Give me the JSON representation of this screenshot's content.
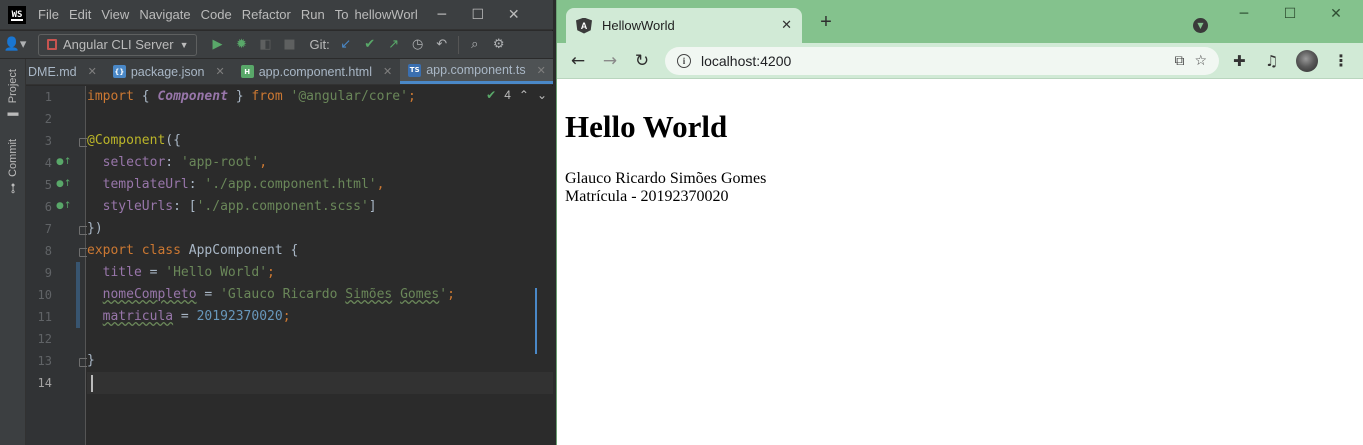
{
  "ide": {
    "menu": [
      "File",
      "Edit",
      "View",
      "Navigate",
      "Code",
      "Refactor",
      "Run",
      "To"
    ],
    "project_name": "hellowWorl",
    "run_config": "Angular CLI Server",
    "git_label": "Git:",
    "side_tabs": [
      "Project",
      "Commit"
    ],
    "tabs": [
      {
        "label": "DME.md",
        "icon": "md"
      },
      {
        "label": "package.json",
        "icon": "json"
      },
      {
        "label": "app.component.html",
        "icon": "html"
      },
      {
        "label": "app.component.ts",
        "icon": "ts",
        "active": true
      }
    ],
    "inspection_count": "4",
    "line_numbers": [
      "1",
      "2",
      "3",
      "4",
      "5",
      "6",
      "7",
      "8",
      "9",
      "10",
      "11",
      "12",
      "13",
      "14"
    ]
  },
  "browser": {
    "tab_title": "HellowWorld",
    "url": "localhost:4200",
    "page": {
      "heading": "Hello World",
      "name": "Glauco Ricardo Simões Gomes",
      "matricula": "Matrícula - 20192370020"
    }
  },
  "colors": {
    "ide_bg": "#2b2b2b",
    "ide_panel": "#3c3f41",
    "browser_frame": "#84c28d",
    "browser_toolbar": "#d1ead6",
    "active_tab_underline": "#4a88c7"
  }
}
